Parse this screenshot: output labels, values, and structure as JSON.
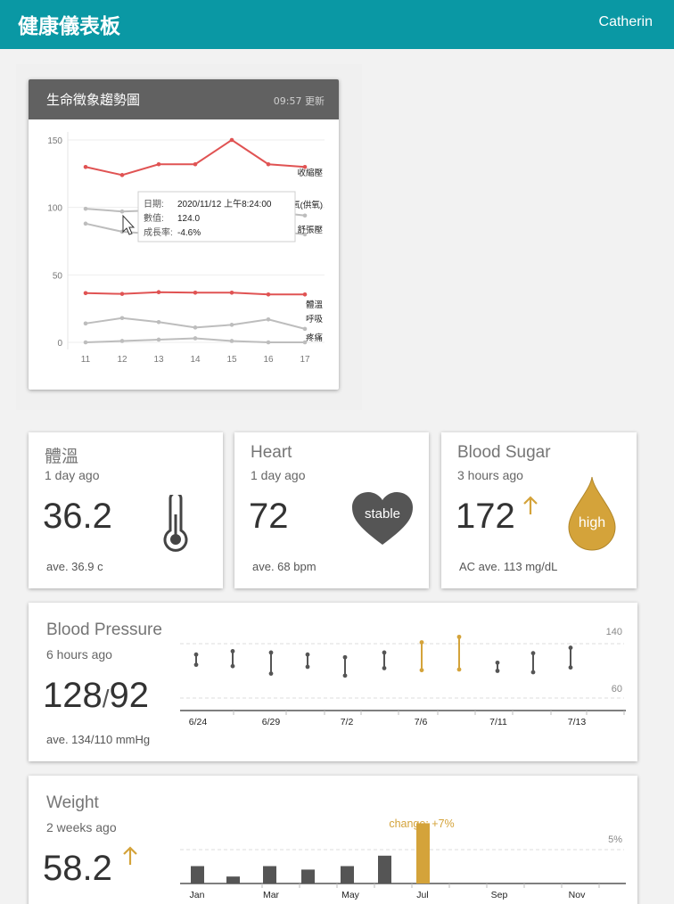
{
  "app": {
    "title": "健康儀表板",
    "user": "Catherin"
  },
  "trend": {
    "title": "生命徵象趨勢圖",
    "updated": "09:57 更新",
    "tooltip": {
      "date_label": "日期:",
      "date_value": "2020/11/12 上午8:24:00",
      "value_label": "數值:",
      "value_value": "124.0",
      "rate_label": "成長率:",
      "rate_value": "-4.6%"
    }
  },
  "chart_data": [
    {
      "type": "line",
      "title": "生命徵象趨勢圖",
      "x": [
        "11",
        "12",
        "13",
        "14",
        "15",
        "16",
        "17"
      ],
      "yticks": [
        "150",
        "100",
        "50",
        "0"
      ],
      "ylim": [
        0,
        150
      ],
      "grid": true,
      "series": [
        {
          "name": "收縮壓",
          "color": "#e05353",
          "values": [
            130,
            124,
            132,
            132,
            150,
            132,
            130
          ]
        },
        {
          "name": "氧(供氧)",
          "color": "#bdbdbd",
          "values": [
            99,
            97,
            98,
            97,
            96,
            97,
            94
          ]
        },
        {
          "name": "舒張壓",
          "color": "#bdbdbd",
          "values": [
            88,
            82,
            80,
            81,
            82,
            83,
            80
          ]
        },
        {
          "name": "體溫",
          "color": "#e05353",
          "values": [
            36.5,
            35.9,
            37.2,
            36.8,
            36.8,
            35.5,
            35.5
          ]
        },
        {
          "name": "呼吸",
          "color": "#bdbdbd",
          "values": [
            14,
            18,
            15,
            11,
            13,
            17,
            10
          ]
        },
        {
          "name": "疼痛",
          "color": "#bdbdbd",
          "values": [
            0,
            1,
            2,
            3,
            1,
            0,
            0
          ]
        }
      ],
      "series_labels": [
        "收縮壓",
        "氧(供氧)",
        "舒張壓",
        "體溫",
        "呼吸",
        "疼痛"
      ]
    },
    {
      "type": "bar",
      "title": "Blood Pressure",
      "categories": [
        "6/24",
        "6/29",
        "7/2",
        "7/6",
        "7/11",
        "7/13"
      ],
      "yticks": [
        "140",
        "60"
      ],
      "ylim": [
        40,
        155
      ],
      "series": [
        {
          "name": "range",
          "values": [
            [
              124,
              109
            ],
            [
              129,
              107
            ],
            [
              127,
              96
            ],
            [
              124,
              106
            ],
            [
              120,
              93
            ],
            [
              127,
              104
            ],
            [
              142,
              101
            ],
            [
              150,
              102
            ],
            [
              112,
              100
            ],
            [
              126,
              98
            ],
            [
              134,
              105
            ]
          ]
        }
      ],
      "highlight_color": "#d4a33a",
      "normal_color": "#555555"
    },
    {
      "type": "bar",
      "title": "Weight",
      "categories": [
        "Jan",
        "Mar",
        "May",
        "Jul",
        "Sep",
        "Nov"
      ],
      "values": [
        54.5,
        53.6,
        54.5,
        54.2,
        54.5,
        55.4,
        58.2
      ],
      "annotation": "change: +7%",
      "ytick": "5%",
      "highlight_color": "#d4a33a",
      "normal_color": "#555555"
    }
  ],
  "cards": {
    "temp": {
      "title": "體溫",
      "ago": "1 day ago",
      "value": "36.2",
      "ave": "ave. 36.9 c"
    },
    "heart": {
      "title": "Heart",
      "ago": "1 day ago",
      "value": "72",
      "badge": "stable",
      "ave": "ave. 68 bpm"
    },
    "sugar": {
      "title": "Blood Sugar",
      "ago": "3 hours ago",
      "value": "172",
      "badge": "high",
      "ave": "AC ave. 113 mg/dL",
      "accent": "#d4a33a"
    },
    "bp": {
      "title": "Blood Pressure",
      "ago": "6 hours ago",
      "systolic": "128",
      "sep": "/",
      "diastolic": "92",
      "ave": "ave. 134/110 mmHg"
    },
    "weight": {
      "title": "Weight",
      "ago": "2 weeks ago",
      "value": "58.2"
    }
  }
}
